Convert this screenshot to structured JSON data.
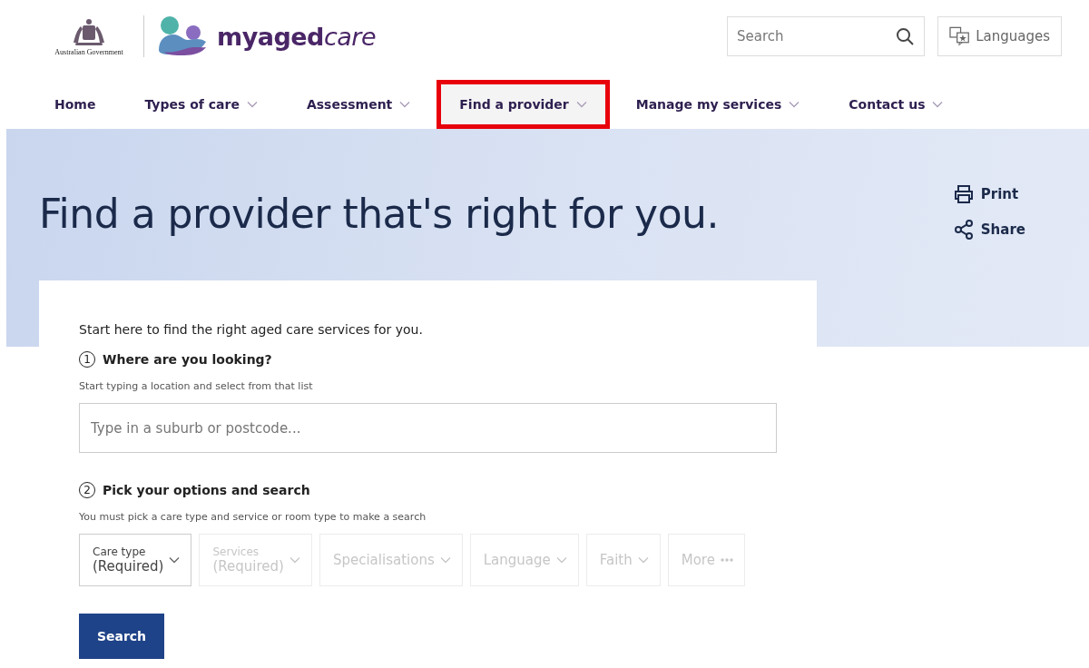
{
  "header": {
    "government": "Australian Government",
    "brand_bold": "myaged",
    "brand_light": "care",
    "search": {
      "placeholder": "Search"
    },
    "languages": "Languages"
  },
  "nav": [
    {
      "label": "Home",
      "dropdown": false,
      "selected": false
    },
    {
      "label": "Types of care",
      "dropdown": true,
      "selected": false
    },
    {
      "label": "Assessment",
      "dropdown": true,
      "selected": false
    },
    {
      "label": "Find a provider",
      "dropdown": true,
      "selected": true
    },
    {
      "label": "Manage my services",
      "dropdown": true,
      "selected": false
    },
    {
      "label": "Contact us",
      "dropdown": true,
      "selected": false
    }
  ],
  "hero": {
    "title": "Find a provider that's right for you.",
    "actions": [
      {
        "kind": "print",
        "label": "Print"
      },
      {
        "kind": "share",
        "label": "Share"
      }
    ]
  },
  "form": {
    "intro": "Start here to find the right aged care services for you.",
    "step1": {
      "number": "1",
      "title": "Where are you looking?",
      "hint": "Start typing a location and select from that list",
      "placeholder": "Type in a suburb or postcode..."
    },
    "step2": {
      "number": "2",
      "title": "Pick your options and search",
      "hint": "You must pick a care type and service or room type to make a search"
    },
    "filters": [
      {
        "kind": "two-line",
        "label": "Care type",
        "value": "(Required)",
        "disabled": false
      },
      {
        "kind": "two-line",
        "label": "Services",
        "value": "(Required)",
        "disabled": true
      },
      {
        "kind": "single",
        "label": "Specialisations",
        "disabled": true
      },
      {
        "kind": "single",
        "label": "Language",
        "disabled": true
      },
      {
        "kind": "single",
        "label": "Faith",
        "disabled": true
      },
      {
        "kind": "more",
        "label": "More",
        "disabled": true
      }
    ],
    "submit": "Search"
  }
}
